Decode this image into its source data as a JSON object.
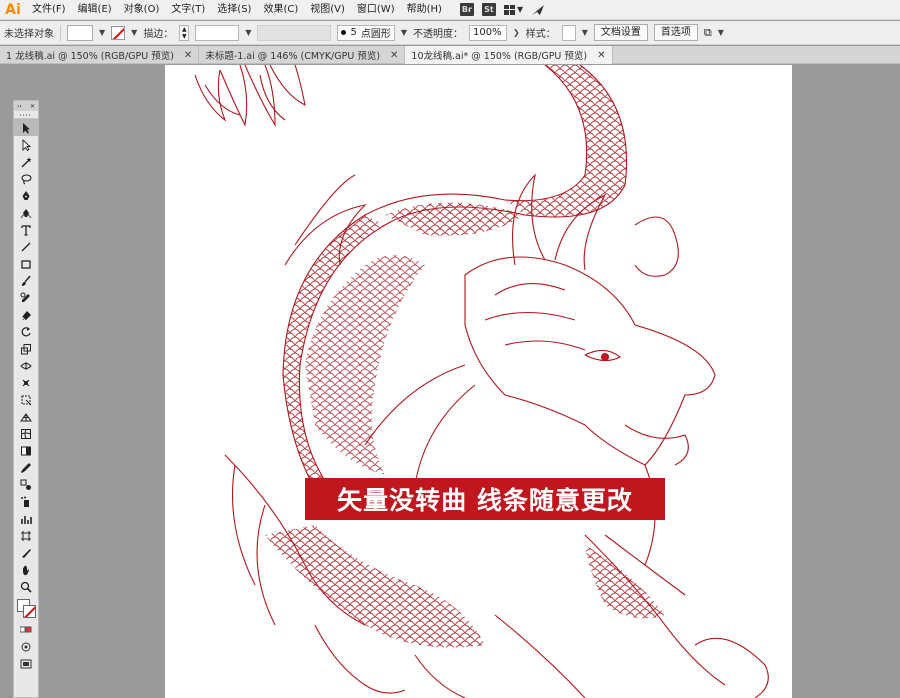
{
  "app": {
    "logo": "Ai"
  },
  "menu": {
    "items": [
      "文件(F)",
      "编辑(E)",
      "对象(O)",
      "文字(T)",
      "选择(S)",
      "效果(C)",
      "视图(V)",
      "窗口(W)",
      "帮助(H)"
    ],
    "badges": [
      "Br",
      "St"
    ]
  },
  "control": {
    "no_selection": "未选择对象",
    "stroke_label": "描边：",
    "brush_size": "5",
    "brush_shape": "点圆形",
    "opacity_label": "不透明度：",
    "opacity_value": "100%",
    "style_label": "样式：",
    "doc_setup": "文档设置",
    "preferences": "首选项"
  },
  "tabs": [
    {
      "label": "1 龙线稿.ai @ 150% (RGB/GPU 预览)",
      "active": false
    },
    {
      "label": "未标题-1.ai @ 146% (CMYK/GPU 预览)",
      "active": false
    },
    {
      "label": "10龙线稿.ai* @ 150% (RGB/GPU 预览)",
      "active": true
    }
  ],
  "artwork": {
    "banner_text": "矢量没转曲 线条随意更改",
    "line_color": "#b0161e",
    "banner_color": "#c0171f"
  },
  "tools": {
    "icons": [
      "selection-tool-icon",
      "direct-selection-tool-icon",
      "magic-wand-tool-icon",
      "lasso-tool-icon",
      "pen-tool-icon",
      "curvature-tool-icon",
      "type-tool-icon",
      "line-tool-icon",
      "rectangle-tool-icon",
      "paintbrush-tool-icon",
      "shaper-tool-icon",
      "eraser-tool-icon",
      "rotate-tool-icon",
      "scale-tool-icon",
      "width-tool-icon",
      "puppet-warp-tool-icon",
      "free-transform-tool-icon",
      "perspective-grid-tool-icon",
      "mesh-tool-icon",
      "gradient-tool-icon",
      "eyedropper-tool-icon",
      "blend-tool-icon",
      "symbol-sprayer-tool-icon",
      "column-graph-tool-icon",
      "artboard-tool-icon",
      "slice-tool-icon",
      "hand-tool-icon",
      "zoom-tool-icon"
    ]
  }
}
